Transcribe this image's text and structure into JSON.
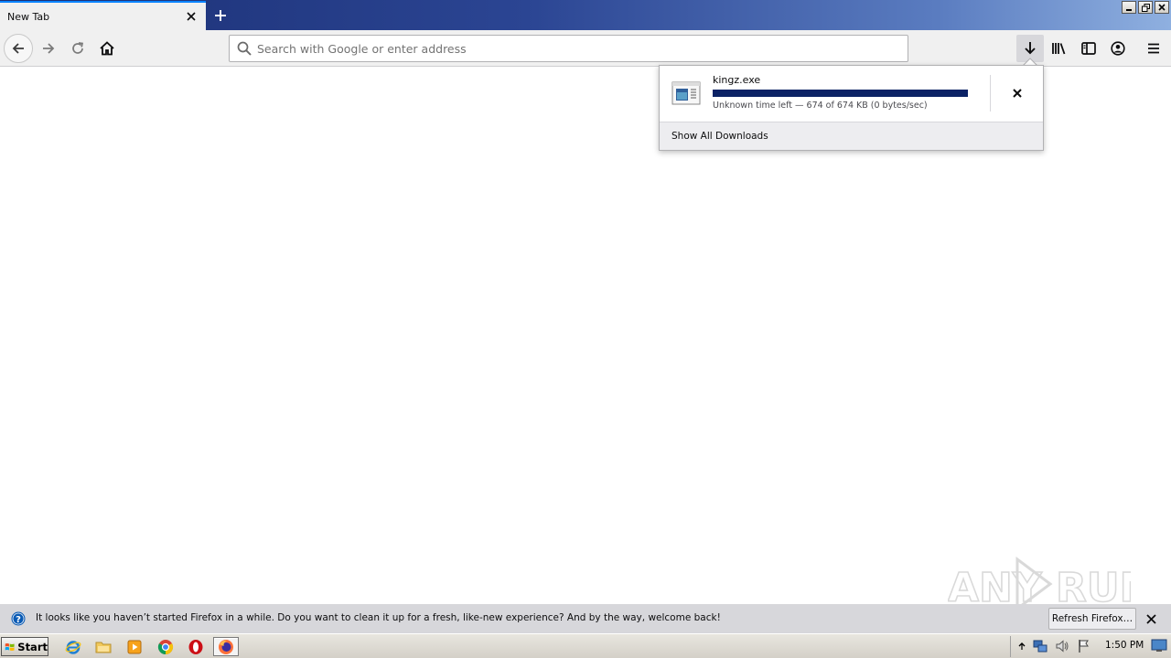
{
  "browser": {
    "tab": {
      "title": "New Tab"
    },
    "urlbar": {
      "placeholder": "Search with Google or enter address",
      "value": ""
    }
  },
  "downloads": {
    "item": {
      "filename": "kingz.exe",
      "status": "Unknown time left — 674 of 674 KB (0 bytes/sec)",
      "progress_fraction": 1.0
    },
    "show_all_label": "Show All Downloads"
  },
  "notification": {
    "message": "It looks like you haven’t started Firefox in a while. Do you want to clean it up for a fresh, like-new experience? And by the way, welcome back!",
    "button_label": "Refresh Firefox…"
  },
  "taskbar": {
    "start_label": "Start",
    "clock": "1:50 PM",
    "apps": [
      "internet-explorer-icon",
      "file-explorer-icon",
      "media-player-icon",
      "chrome-icon",
      "opera-icon",
      "firefox-icon"
    ]
  },
  "watermark": {
    "text": "ANY RUN"
  },
  "colors": {
    "progress": "#0b2265",
    "tab_accent": "#0a84ff",
    "notification_bg": "#d7d7db"
  }
}
